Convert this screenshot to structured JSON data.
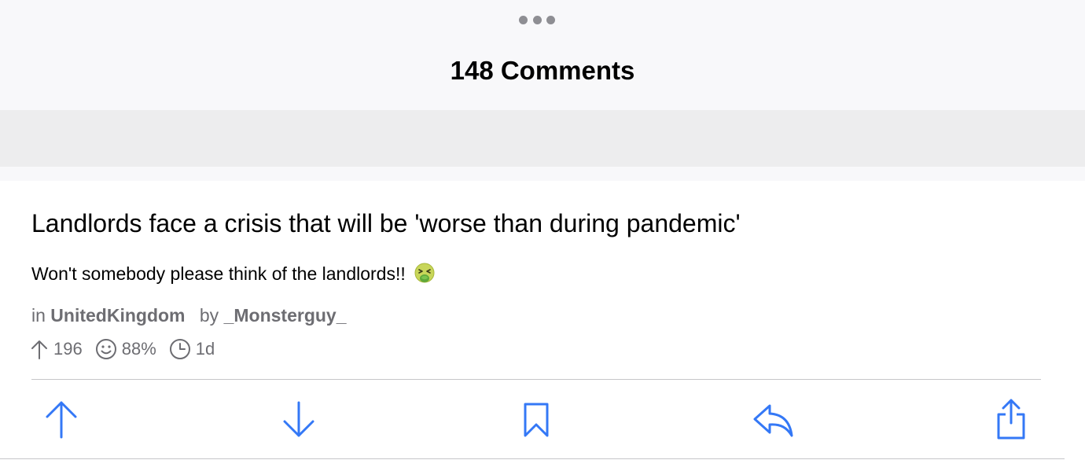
{
  "sheet": {
    "title": "148 Comments"
  },
  "post": {
    "title": "Landlords face a crisis that will be 'worse than during pandemic'",
    "body": "Won't somebody please think of the landlords!!",
    "meta": {
      "in_label": "in",
      "subreddit": "UnitedKingdom",
      "by_label": "by",
      "author": "_Monsterguy_"
    },
    "stats": {
      "upvotes": "196",
      "upvote_ratio": "88%",
      "age": "1d"
    }
  },
  "actions": [
    {
      "name": "upvote",
      "icon": "arrow-up-icon"
    },
    {
      "name": "downvote",
      "icon": "arrow-down-icon"
    },
    {
      "name": "save",
      "icon": "bookmark-icon"
    },
    {
      "name": "reply",
      "icon": "reply-icon"
    },
    {
      "name": "share",
      "icon": "share-icon"
    }
  ],
  "colors": {
    "accent": "#3478f6",
    "secondary_text": "#6d6d72",
    "header_bg": "#f8f8fa"
  }
}
